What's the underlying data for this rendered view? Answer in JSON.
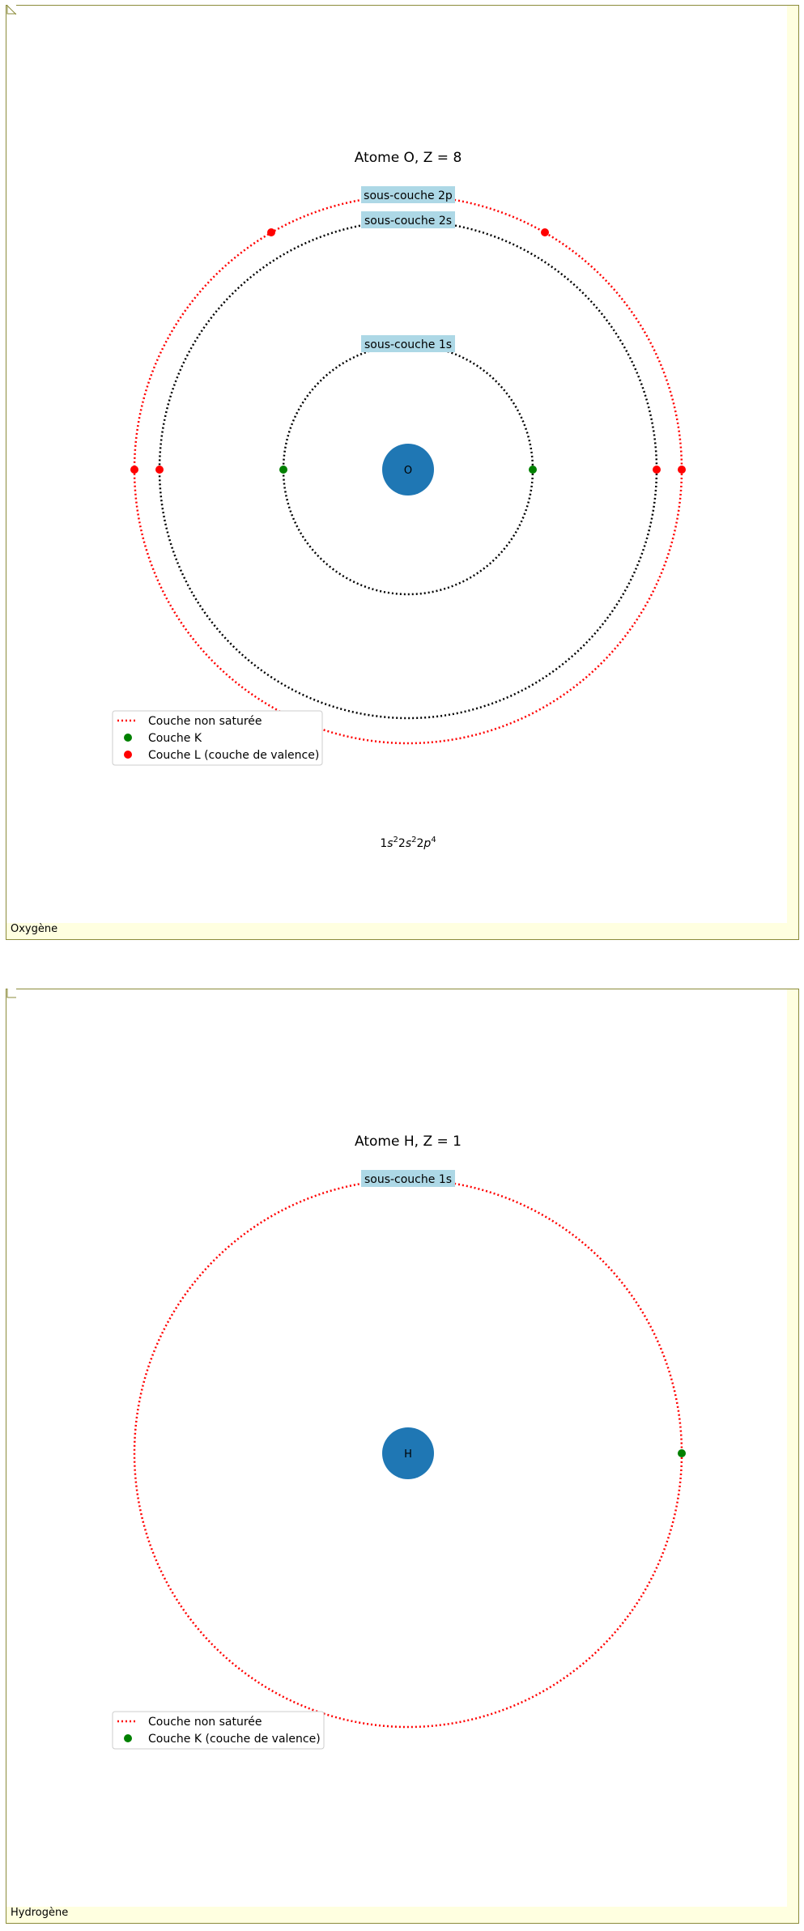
{
  "oxygen": {
    "caption": "Oxygène",
    "title": "Atome O, Z = 8",
    "nucleus": "O",
    "subshells": {
      "s2p": "sous-couche 2p",
      "s2s": "sous-couche 2s",
      "s1s": "sous-couche 1s"
    },
    "legend": [
      "Couche non saturée",
      "Couche K",
      "Couche L (couche de valence)"
    ],
    "config": {
      "n1": "1",
      "s1": "s",
      "e1": "2",
      "n2": "2",
      "s2": "s",
      "e2": "2",
      "n3": "2",
      "s3": "p",
      "e3": "4"
    }
  },
  "hydrogen": {
    "caption": "Hydrogène",
    "title": "Atome H, Z = 1",
    "nucleus": "H",
    "subshells": {
      "s1s": "sous-couche 1s"
    },
    "legend": [
      "Couche non saturée",
      "Couche K (couche de valence)"
    ]
  },
  "colors": {
    "nucleus": "#1f77b4",
    "label_box": "#add8e6",
    "shell_full": "#000000",
    "shell_unsaturated": "#ff0000",
    "electron_k": "#008000",
    "electron_l": "#ff0000",
    "panel_bg": "#ffffe0",
    "panel_border": "#8b8b3a"
  }
}
